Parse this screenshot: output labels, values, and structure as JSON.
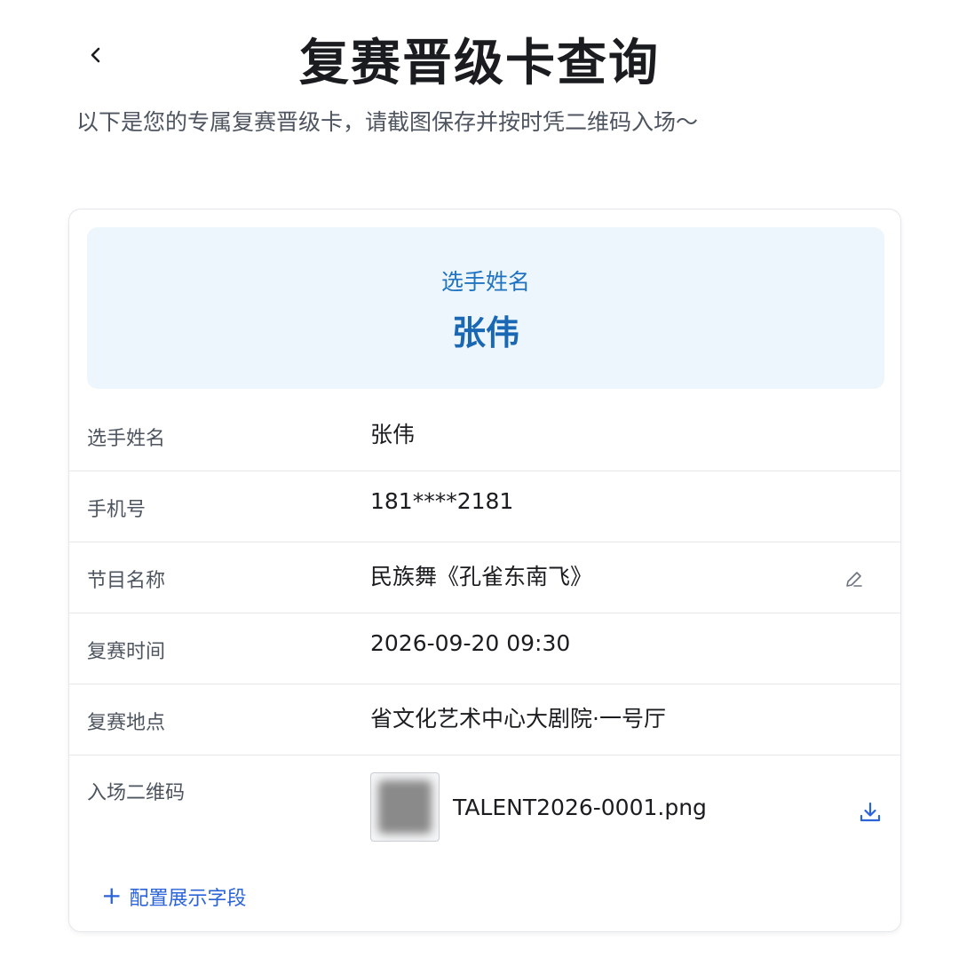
{
  "header": {
    "title": "复赛晋级卡查询",
    "subtitle": "以下是您的专属复赛晋级卡，请截图保存并按时凭二维码入场～"
  },
  "hero": {
    "label": "选手姓名",
    "value": "张伟"
  },
  "fields": [
    {
      "label": "选手姓名",
      "value": "张伟"
    },
    {
      "label": "手机号",
      "value": "181****2181"
    },
    {
      "label": "节目名称",
      "value": "民族舞《孔雀东南飞》"
    },
    {
      "label": "复赛时间",
      "value": "2026-09-20 09:30"
    },
    {
      "label": "复赛地点",
      "value": "省文化艺术中心大剧院·一号厅"
    }
  ],
  "qr": {
    "label": "入场二维码",
    "filename": "TALENT2026-0001.png"
  },
  "actions": {
    "add_field_label": "配置展示字段"
  },
  "colors": {
    "accent": "#2b63d9",
    "hero_bg": "#edf6fd",
    "hero_text": "#1a68b3"
  },
  "icons": [
    "chevron-left-icon",
    "edit-pencil-icon",
    "download-icon",
    "plus-icon"
  ]
}
